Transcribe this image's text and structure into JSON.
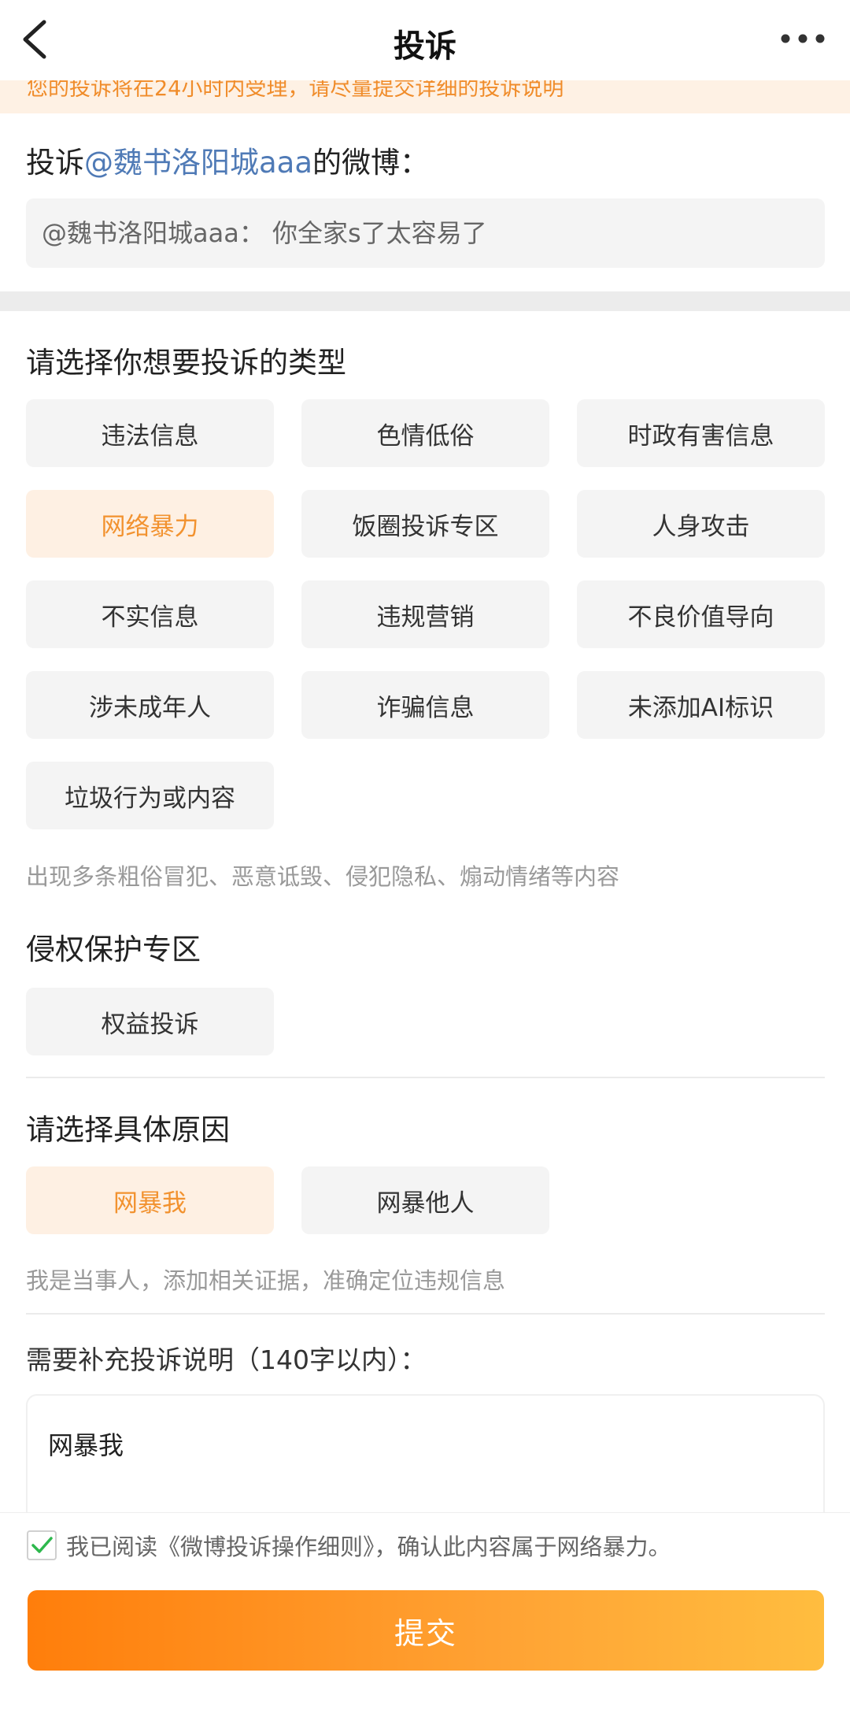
{
  "header": {
    "title": "投诉",
    "back_icon": "chevron-left-icon",
    "more_icon": "more-horizontal-icon"
  },
  "notice": {
    "text": "您的投诉将在24小时内受理，请尽量提交详细的投诉说明"
  },
  "target": {
    "prefix": "投诉",
    "mention": "@魏书洛阳城aaa",
    "suffix": "的微博：",
    "quote": "@魏书洛阳城aaa： 你全家s了太容易了"
  },
  "complaint_type": {
    "title": "请选择你想要投诉的类型",
    "options": [
      {
        "label": "违法信息",
        "selected": false
      },
      {
        "label": "色情低俗",
        "selected": false
      },
      {
        "label": "时政有害信息",
        "selected": false
      },
      {
        "label": "网络暴力",
        "selected": true
      },
      {
        "label": "饭圈投诉专区",
        "selected": false
      },
      {
        "label": "人身攻击",
        "selected": false
      },
      {
        "label": "不实信息",
        "selected": false
      },
      {
        "label": "违规营销",
        "selected": false
      },
      {
        "label": "不良价值导向",
        "selected": false
      },
      {
        "label": "涉未成年人",
        "selected": false
      },
      {
        "label": "诈骗信息",
        "selected": false
      },
      {
        "label": "未添加AI标识",
        "selected": false
      },
      {
        "label": "垃圾行为或内容",
        "selected": false
      }
    ],
    "hint": "出现多条粗俗冒犯、恶意诋毁、侵犯隐私、煽动情绪等内容"
  },
  "rights": {
    "title": "侵权保护专区",
    "option": "权益投诉"
  },
  "reason": {
    "title": "请选择具体原因",
    "options": [
      {
        "label": "网暴我",
        "selected": true
      },
      {
        "label": "网暴他人",
        "selected": false
      }
    ],
    "hint": "我是当事人，添加相关证据，准确定位违规信息"
  },
  "description": {
    "label": "需要补充投诉说明（140字以内）：",
    "value": "网暴我"
  },
  "agreement": {
    "checked": true,
    "text": "我已阅读《微博投诉操作细则》，确认此内容属于网络暴力。"
  },
  "submit": {
    "label": "提交"
  },
  "colors": {
    "accent": "#f2922f",
    "selected_bg": "#fef0e3",
    "mention": "#4f7ab6",
    "checkmark": "#2db84d"
  }
}
